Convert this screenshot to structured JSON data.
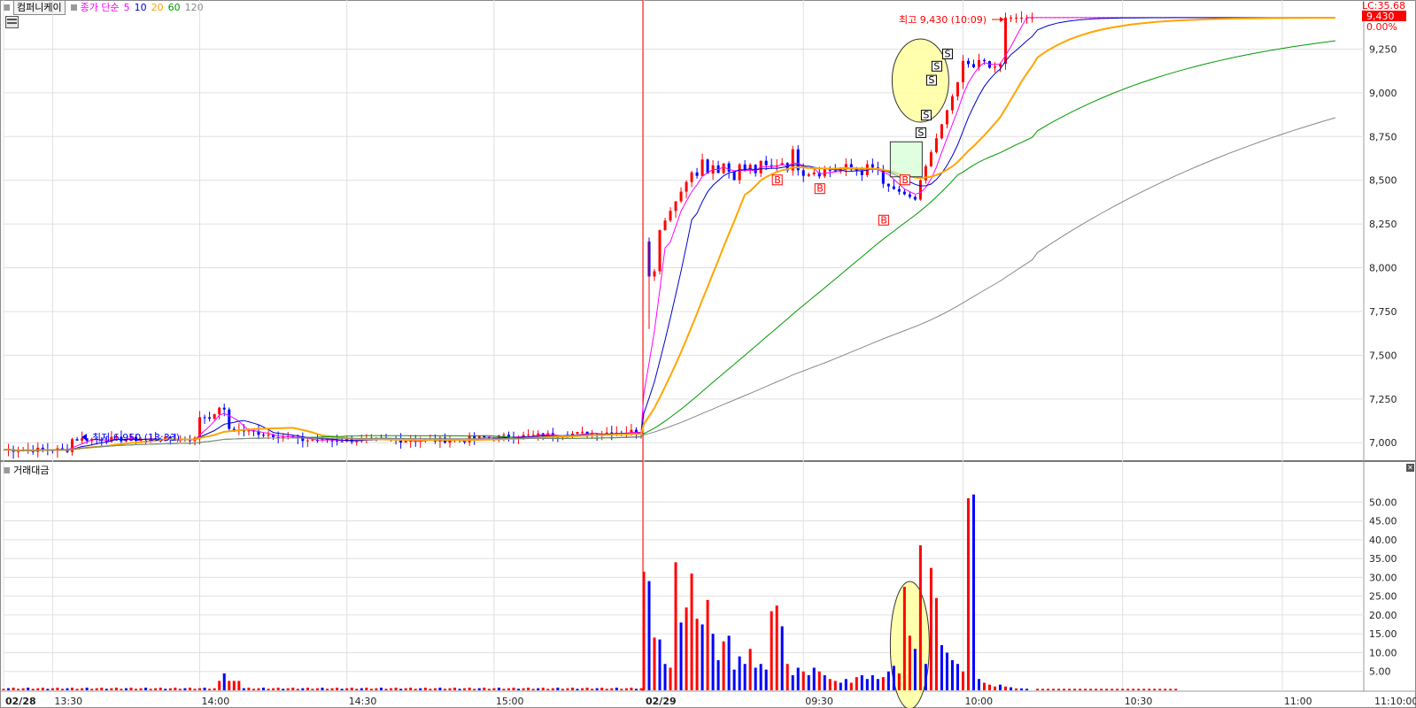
{
  "header": {
    "stock_name": "컴퍼니케이",
    "ma_title": "종가 단순",
    "ma_periods": [
      "5",
      "10",
      "20",
      "60",
      "120"
    ],
    "volume_panel_title": "거래대금"
  },
  "colors": {
    "up": "#ff0000",
    "down": "#0000ff",
    "ma5": "#ff00ff",
    "ma10": "#0000cc",
    "ma20": "#ffa500",
    "ma60": "#009900",
    "ma120": "#888888",
    "grid": "#e0e0e0",
    "highlight": "#ffff99"
  },
  "chart_data": [
    {
      "type": "candlestick",
      "title": "컴퍼니케이",
      "x_tick_labels": [
        "02/28",
        "13:30",
        "14:00",
        "14:30",
        "15:00",
        "02/29",
        "09:30",
        "10:00",
        "10:30",
        "11:00",
        "11:10:00"
      ],
      "y_tick_labels": [
        "9,250",
        "9,000",
        "8,750",
        "8,500",
        "8,250",
        "8,000",
        "7,750",
        "7,500",
        "7,250",
        "7,000"
      ],
      "ylim": [
        6900,
        9480
      ],
      "price_annotations": {
        "high_label": "최고 9,430 (10:09)",
        "low_label": "최저 6,950 (13:33)",
        "last_price": "9,430",
        "change_pct": "0.00%",
        "lc_label": "LC:35.68"
      },
      "signals": {
        "buy": "B",
        "sell": "S"
      },
      "session_day1": {
        "label": "02/28",
        "price_range": [
          6950,
          7270
        ],
        "typical_close": 7010
      },
      "session_day2": {
        "label": "02/29",
        "open_gap_high": 8150,
        "first_low": 7650,
        "consolidation_range": [
          8350,
          8850
        ],
        "breakout_high": 9430
      },
      "series": [
        {
          "name": "5",
          "color": "#ff00ff"
        },
        {
          "name": "10",
          "color": "#0000cc"
        },
        {
          "name": "20",
          "color": "#ffa500"
        },
        {
          "name": "60",
          "color": "#009900"
        },
        {
          "name": "120",
          "color": "#888888"
        }
      ]
    },
    {
      "type": "bar",
      "title": "거래대금",
      "y_tick_labels": [
        "50.00",
        "45.00",
        "40.00",
        "35.00",
        "30.00",
        "25.00",
        "20.00",
        "15.00",
        "10.00",
        "5.00"
      ],
      "ylim": [
        0,
        55
      ],
      "notable_values": [
        {
          "time": "09:00",
          "value": 31.5,
          "dir": "up"
        },
        {
          "time": "09:01",
          "value": 29.0,
          "dir": "down"
        },
        {
          "time": "09:08",
          "value": 34.0,
          "dir": "up"
        },
        {
          "time": "09:12",
          "value": 31.0,
          "dir": "up"
        },
        {
          "time": "09:54",
          "value": 27.5,
          "dir": "up"
        },
        {
          "time": "09:58",
          "value": 38.5,
          "dir": "up"
        },
        {
          "time": "10:00",
          "value": 32.5,
          "dir": "up"
        },
        {
          "time": "10:01",
          "value": 24.5,
          "dir": "down"
        },
        {
          "time": "10:09",
          "value": 51.0,
          "dir": "up"
        },
        {
          "time": "10:10",
          "value": 52.0,
          "dir": "up"
        }
      ]
    }
  ]
}
